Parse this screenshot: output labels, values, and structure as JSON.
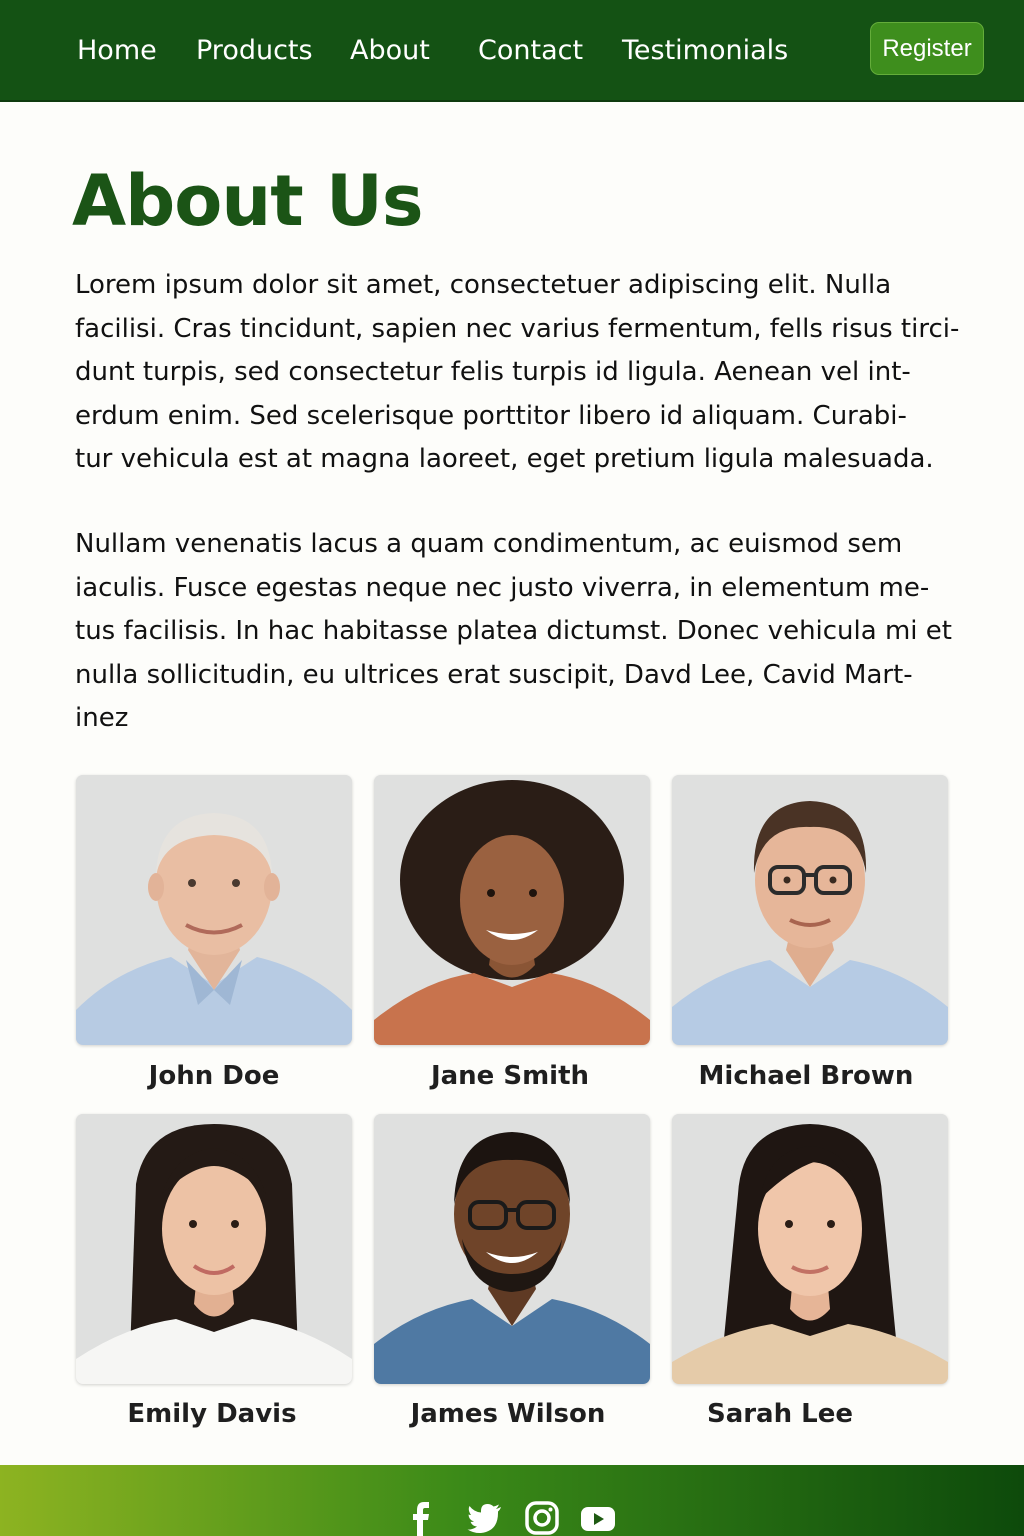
{
  "nav": {
    "items": [
      {
        "label": "Home"
      },
      {
        "label": "Products"
      },
      {
        "label": "About"
      },
      {
        "label": "Contact"
      },
      {
        "label": "Testimonials"
      }
    ],
    "register_label": "Register"
  },
  "colors": {
    "header_bg": "#145214",
    "accent_button": "#3e8e1d",
    "title_green": "#1b5416",
    "footer_gradient": [
      "#8db321",
      "#3b8a18",
      "#0d4a0b"
    ]
  },
  "main": {
    "title": "About Us",
    "paragraph1_lines": [
      "Lorem ipsum dolor sit amet, consectetuer adipiscing elit. Nulla",
      "facilisi. Cras tincidunt, sapien nec varius fermentum, fells risus tirci-",
      "dunt turpis, sed consectetur felis turpis id ligula. Aenean vel int-",
      "erdum enim. Sed scelerisque porttitor libero id aliquam. Curabi-",
      "tur vehicula est at magna laoreet, eget pretium ligula malesuada."
    ],
    "paragraph2_lines": [
      "Nullam venenatis lacus a quam condimentum, ac euismod sem",
      "iaculis. Fusce egestas neque nec justo viverra, in elementum me-",
      "tus facilisis. In hac habitasse platea dictumst. Donec vehicula mi et",
      "nulla sollicitudin, eu ultrices erat suscipit, Davd Lee, Cavid Mart-",
      "inez"
    ]
  },
  "team": [
    {
      "name": "John Doe"
    },
    {
      "name": "Jane Smith"
    },
    {
      "name": "Michael Brown"
    },
    {
      "name": "Emily Davis"
    },
    {
      "name": "James Wilson"
    },
    {
      "name": "Sarah Lee"
    }
  ],
  "footer": {
    "social_icons": [
      "facebook-icon",
      "twitter-icon",
      "instagram-icon",
      "youtube-icon"
    ]
  }
}
